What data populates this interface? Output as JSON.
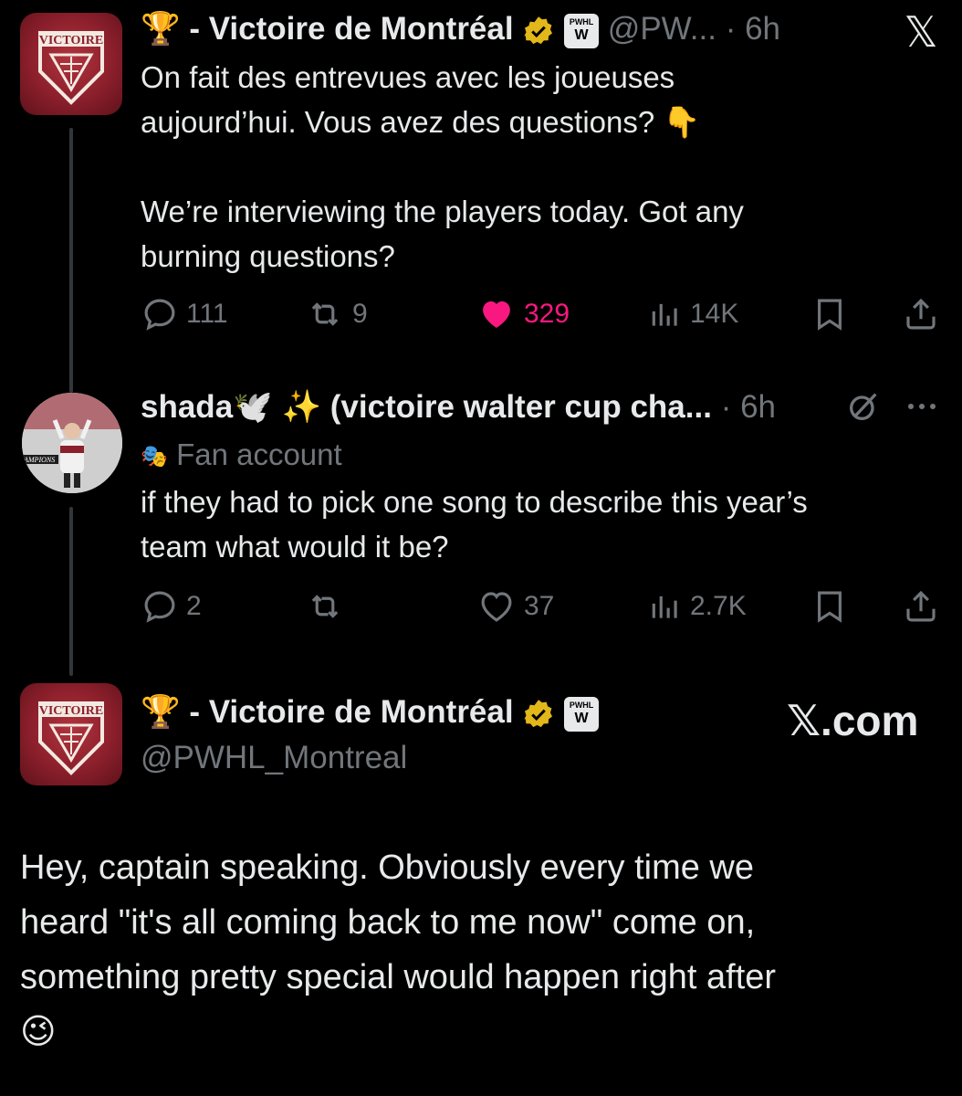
{
  "tweet1": {
    "trophy": "🏆",
    "name": "- Victoire de Montréal",
    "handle": "@PW...",
    "dot": "·",
    "time": "6h",
    "line1": "On fait des entrevues avec les joueuses",
    "line2": "aujourd’hui. Vous avez des questions? 👇",
    "line3": "We’re interviewing the players today. Got any",
    "line4": "burning questions?",
    "replies": "111",
    "retweets": "9",
    "likes": "329",
    "views": "14K",
    "avatar_text": "VICTOIRE",
    "badge_text": "PWHL"
  },
  "close_label": "𝕏",
  "tweet2": {
    "name": "shada🕊️ ✨ (victoire walter cup cha...",
    "dot": "·",
    "time": "6h",
    "tag_icon": "🎭",
    "tag": "Fan account",
    "line1": "if they had to pick one song to describe this year’s",
    "line2": "team what would it be?",
    "replies": "2",
    "likes": "37",
    "views": "2.7K",
    "avatar_text": "AMPIONS"
  },
  "tweet3": {
    "trophy": "🏆",
    "name": "- Victoire de Montréal",
    "handle": "@PWHL_Montreal",
    "brand": "𝕏.com",
    "line1": "Hey, captain speaking. Obviously every time we",
    "line2": "heard \"it's all coming back to me now\" come on,",
    "line3": "something pretty special would happen right after",
    "emoji": "😉",
    "avatar_text": "VICTOIRE",
    "badge_text": "PWHL"
  },
  "colors": {
    "background": "#000000",
    "text": "#e7e9ea",
    "muted": "#71767b",
    "like": "#f91880",
    "verified_gold": "#e2b719",
    "avatar_red": "#8b1f2b"
  }
}
